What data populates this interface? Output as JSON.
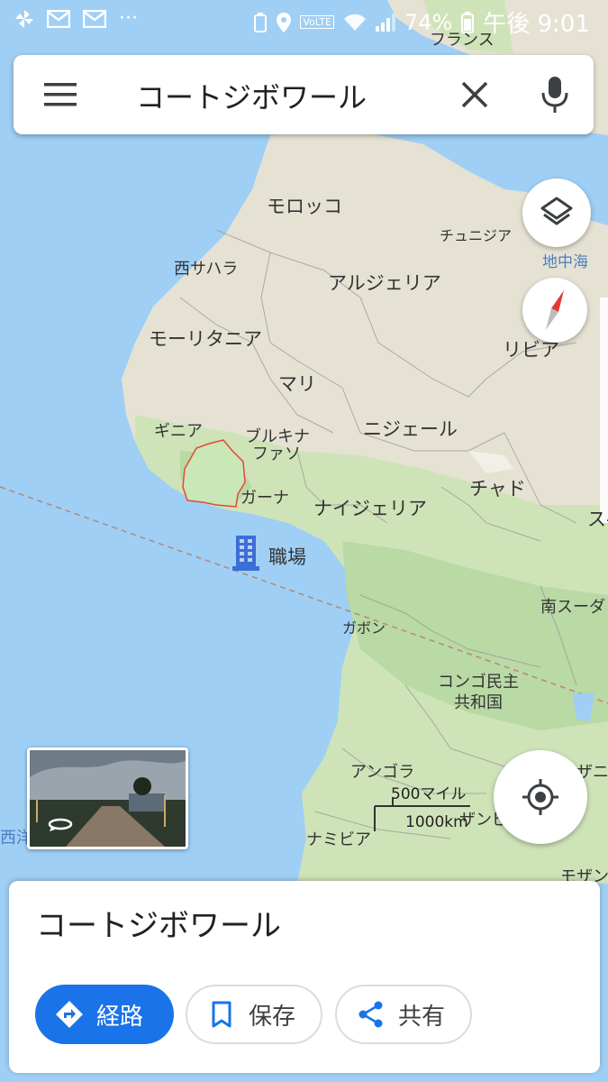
{
  "status_bar": {
    "battery_percent": "74%",
    "time": "午後 9:01",
    "volte": "VoLTE"
  },
  "search": {
    "query": "コートジボワール"
  },
  "map_labels": {
    "france": "フランス",
    "morocco": "モロッコ",
    "tunisia": "チュニジア",
    "mediterranean": "地中海",
    "western_sahara": "西サハラ",
    "algeria": "アルジェリア",
    "mauritania": "モーリタニア",
    "libya": "リビア",
    "mali": "マリ",
    "guinea": "ギニア",
    "burkina_1": "ブルキナ",
    "burkina_2": "ファソ",
    "niger": "ニジェール",
    "chad": "チャド",
    "ghana": "ガーナ",
    "nigeria": "ナイジェリア",
    "sudan_partial": "ス-",
    "workplace": "職場",
    "south_sudan": "南スーダ",
    "gabon": "ガボン",
    "drc_1": "コンゴ民主",
    "drc_2": "共和国",
    "angola": "アンゴラ",
    "zambia_partial": "ザンビ",
    "tanzania_partial": "ザニ",
    "namibia": "ナミビア",
    "mozambique_partial": "モザン",
    "atlantic_partial": "西洋"
  },
  "scale": {
    "miles": "500マイル",
    "km": "1000km"
  },
  "place_sheet": {
    "title": "コートジボワール",
    "directions_label": "経路",
    "save_label": "保存",
    "share_label": "共有"
  },
  "colors": {
    "water": "#9fcff5",
    "land": "#e6e2d3",
    "forest": "#b9d9a5",
    "accent_blue": "#1a73e8",
    "selected_border": "#e04a3a"
  },
  "icons": [
    "menu-icon",
    "clear-icon",
    "mic-icon",
    "layers-icon",
    "compass-icon",
    "my-location-icon",
    "directions-icon",
    "bookmark-icon",
    "share-icon",
    "work-icon",
    "street-view-icon"
  ]
}
